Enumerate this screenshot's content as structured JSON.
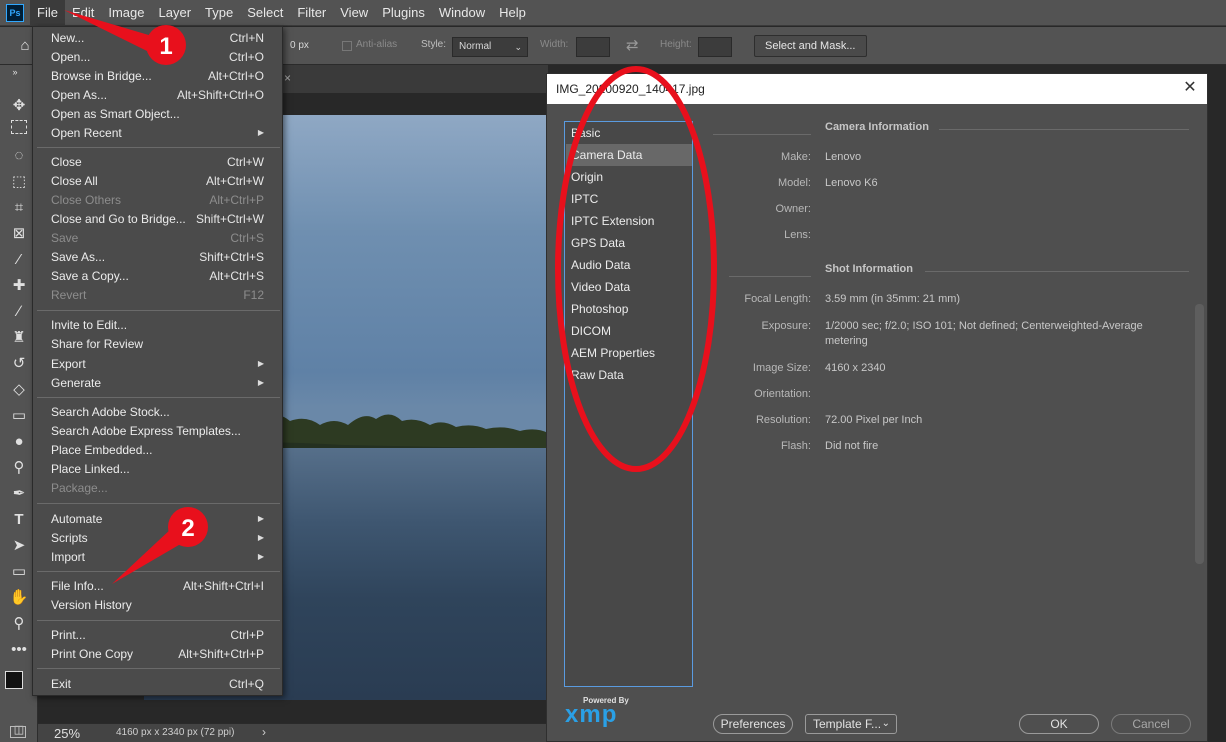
{
  "menubar": {
    "logo": "Ps",
    "items": [
      "File",
      "Edit",
      "Image",
      "Layer",
      "Type",
      "Select",
      "Filter",
      "View",
      "Plugins",
      "Window",
      "Help"
    ]
  },
  "options_bar": {
    "feather_value": "0 px",
    "anti_alias_label": "Anti-alias",
    "style_label": "Style:",
    "style_value": "Normal",
    "width_label": "Width:",
    "height_label": "Height:",
    "select_mask_label": "Select and Mask..."
  },
  "status_bar": {
    "zoom": "25%",
    "doc_info": "4160 px x 2340 px (72 ppi)"
  },
  "file_menu": {
    "items": [
      {
        "label": "New...",
        "shortcut": "Ctrl+N"
      },
      {
        "label": "Open...",
        "shortcut": "Ctrl+O"
      },
      {
        "label": "Browse in Bridge...",
        "shortcut": "Alt+Ctrl+O"
      },
      {
        "label": "Open As...",
        "shortcut": "Alt+Shift+Ctrl+O"
      },
      {
        "label": "Open as Smart Object...",
        "shortcut": ""
      },
      {
        "label": "Open Recent",
        "shortcut": ""
      },
      {
        "label": "Close",
        "shortcut": "Ctrl+W"
      },
      {
        "label": "Close All",
        "shortcut": "Alt+Ctrl+W"
      },
      {
        "label": "Close Others",
        "shortcut": "Alt+Ctrl+P"
      },
      {
        "label": "Close and Go to Bridge...",
        "shortcut": "Shift+Ctrl+W"
      },
      {
        "label": "Save",
        "shortcut": "Ctrl+S"
      },
      {
        "label": "Save As...",
        "shortcut": "Shift+Ctrl+S"
      },
      {
        "label": "Save a Copy...",
        "shortcut": "Alt+Ctrl+S"
      },
      {
        "label": "Revert",
        "shortcut": "F12"
      },
      {
        "label": "Invite to Edit...",
        "shortcut": ""
      },
      {
        "label": "Share for Review",
        "shortcut": ""
      },
      {
        "label": "Export",
        "shortcut": ""
      },
      {
        "label": "Generate",
        "shortcut": ""
      },
      {
        "label": "Search Adobe Stock...",
        "shortcut": ""
      },
      {
        "label": "Search Adobe Express Templates...",
        "shortcut": ""
      },
      {
        "label": "Place Embedded...",
        "shortcut": ""
      },
      {
        "label": "Place Linked...",
        "shortcut": ""
      },
      {
        "label": "Package...",
        "shortcut": ""
      },
      {
        "label": "Automate",
        "shortcut": ""
      },
      {
        "label": "Scripts",
        "shortcut": ""
      },
      {
        "label": "Import",
        "shortcut": ""
      },
      {
        "label": "File Info...",
        "shortcut": "Alt+Shift+Ctrl+I"
      },
      {
        "label": "Version History",
        "shortcut": ""
      },
      {
        "label": "Print...",
        "shortcut": "Ctrl+P"
      },
      {
        "label": "Print One Copy",
        "shortcut": "Alt+Shift+Ctrl+P"
      },
      {
        "label": "Exit",
        "shortcut": "Ctrl+Q"
      }
    ]
  },
  "dialog": {
    "title": "IMG_20200920_140417.jpg",
    "categories": [
      "Basic",
      "Camera Data",
      "Origin",
      "IPTC",
      "IPTC Extension",
      "GPS Data",
      "Audio Data",
      "Video Data",
      "Photoshop",
      "DICOM",
      "AEM Properties",
      "Raw Data"
    ],
    "selected_category": "Camera Data",
    "camera_section_title": "Camera Information",
    "camera_fields": [
      {
        "label": "Make:",
        "value": "Lenovo"
      },
      {
        "label": "Model:",
        "value": "Lenovo K6"
      },
      {
        "label": "Owner:",
        "value": ""
      },
      {
        "label": "Lens:",
        "value": ""
      }
    ],
    "shot_section_title": "Shot Information",
    "shot_fields": [
      {
        "label": "Focal Length:",
        "value": "3.59 mm   (in 35mm: 21 mm)"
      },
      {
        "label": "Exposure:",
        "value": "1/2000 sec;   f/2.0;   ISO 101;   Not defined;   Centerweighted-Average metering"
      },
      {
        "label": "Image Size:",
        "value": "4160 x 2340"
      },
      {
        "label": "Orientation:",
        "value": ""
      },
      {
        "label": "Resolution:",
        "value": "72.00 Pixel per Inch"
      },
      {
        "label": "Flash:",
        "value": "Did not fire"
      }
    ],
    "powered_by": "Powered By",
    "xmp_logo": "xmp",
    "preferences_label": "Preferences",
    "template_label": "Template F...",
    "ok_label": "OK",
    "cancel_label": "Cancel"
  },
  "annotations": {
    "marker_1": "1",
    "marker_2": "2",
    "color": "#e8101c"
  }
}
